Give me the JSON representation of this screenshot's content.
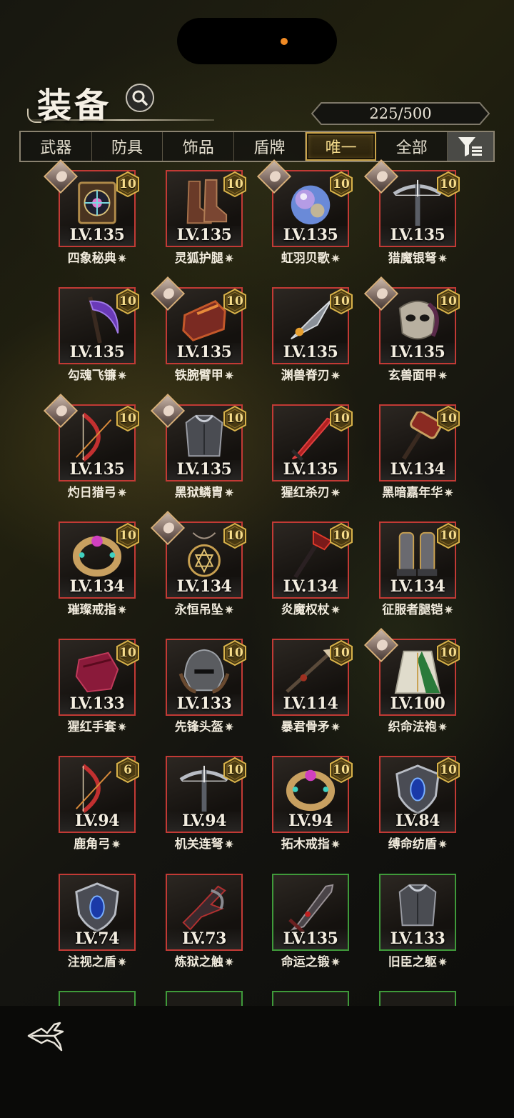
{
  "header": {
    "title": "装备",
    "count": "225/500"
  },
  "tabs": [
    {
      "label": "武器"
    },
    {
      "label": "防具"
    },
    {
      "label": "饰品"
    },
    {
      "label": "盾牌"
    },
    {
      "label": "唯一",
      "active": true
    },
    {
      "label": "全部"
    }
  ],
  "colors": {
    "rare": "#c23a35",
    "uncommon": "#3f9a3a",
    "gold": "#c8a24a"
  },
  "items": [
    {
      "name": "四象秘典",
      "level": "LV.135",
      "enhance": "10",
      "avatar": true,
      "frame": "red",
      "icon": "tome-icon"
    },
    {
      "name": "灵狐护腿",
      "level": "LV.135",
      "enhance": "10",
      "avatar": false,
      "frame": "red",
      "icon": "boots-icon"
    },
    {
      "name": "虹羽贝歌",
      "level": "LV.135",
      "enhance": "10",
      "avatar": true,
      "frame": "red",
      "icon": "orb-icon"
    },
    {
      "name": "猎魔银弩",
      "level": "LV.135",
      "enhance": "10",
      "avatar": true,
      "frame": "red",
      "icon": "crossbow-icon"
    },
    {
      "name": "勾魂飞镰",
      "level": "LV.135",
      "enhance": "10",
      "avatar": false,
      "frame": "red",
      "icon": "scythe-icon"
    },
    {
      "name": "铁腕臂甲",
      "level": "LV.135",
      "enhance": "10",
      "avatar": true,
      "frame": "red",
      "icon": "gauntlet-icon"
    },
    {
      "name": "渊兽脊刃",
      "level": "LV.135",
      "enhance": "10",
      "avatar": false,
      "frame": "red",
      "icon": "blade-icon"
    },
    {
      "name": "玄兽面甲",
      "level": "LV.135",
      "enhance": "10",
      "avatar": true,
      "frame": "red",
      "icon": "mask-icon"
    },
    {
      "name": "灼日猎弓",
      "level": "LV.135",
      "enhance": "10",
      "avatar": true,
      "frame": "red",
      "icon": "bow-icon"
    },
    {
      "name": "黑狱鳞胄",
      "level": "LV.135",
      "enhance": "10",
      "avatar": true,
      "frame": "red",
      "icon": "armor-icon"
    },
    {
      "name": "猩红杀刃",
      "level": "LV.135",
      "enhance": "10",
      "avatar": false,
      "frame": "red",
      "icon": "sword-icon"
    },
    {
      "name": "黑暗嘉年华",
      "level": "LV.134",
      "enhance": "10",
      "avatar": false,
      "frame": "red",
      "icon": "hammer-icon"
    },
    {
      "name": "璀璨戒指",
      "level": "LV.134",
      "enhance": "10",
      "avatar": false,
      "frame": "red",
      "icon": "ring-icon"
    },
    {
      "name": "永恒吊坠",
      "level": "LV.134",
      "enhance": "10",
      "avatar": true,
      "frame": "red",
      "icon": "pendant-icon"
    },
    {
      "name": "炎魔权杖",
      "level": "LV.134",
      "enhance": "10",
      "avatar": false,
      "frame": "red",
      "icon": "staff-icon"
    },
    {
      "name": "征服者腿铠",
      "level": "LV.134",
      "enhance": "10",
      "avatar": false,
      "frame": "red",
      "icon": "greaves-icon"
    },
    {
      "name": "猩红手套",
      "level": "LV.133",
      "enhance": "10",
      "avatar": false,
      "frame": "red",
      "icon": "glove-icon"
    },
    {
      "name": "先锋头盔",
      "level": "LV.133",
      "enhance": "10",
      "avatar": false,
      "frame": "red",
      "icon": "helmet-icon"
    },
    {
      "name": "暴君骨矛",
      "level": "LV.114",
      "enhance": "10",
      "avatar": false,
      "frame": "red",
      "icon": "spear-icon"
    },
    {
      "name": "织命法袍",
      "level": "LV.100",
      "enhance": "10",
      "avatar": true,
      "frame": "red",
      "icon": "robe-icon"
    },
    {
      "name": "鹿角弓",
      "level": "LV.94",
      "enhance": "6",
      "avatar": false,
      "frame": "red",
      "icon": "bow-icon"
    },
    {
      "name": "机关连弩",
      "level": "LV.94",
      "enhance": "10",
      "avatar": false,
      "frame": "red",
      "icon": "crossbow-icon"
    },
    {
      "name": "拓木戒指",
      "level": "LV.94",
      "enhance": "10",
      "avatar": false,
      "frame": "red",
      "icon": "ring-icon"
    },
    {
      "name": "缚命纺盾",
      "level": "LV.84",
      "enhance": "10",
      "avatar": false,
      "frame": "red",
      "icon": "shield-icon"
    },
    {
      "name": "注视之盾",
      "level": "LV.74",
      "enhance": null,
      "avatar": false,
      "frame": "red",
      "icon": "shield-icon"
    },
    {
      "name": "炼狱之触",
      "level": "LV.73",
      "enhance": null,
      "avatar": false,
      "frame": "red",
      "icon": "claw-icon"
    },
    {
      "name": "命运之锻",
      "level": "LV.135",
      "enhance": null,
      "avatar": false,
      "frame": "green",
      "icon": "greatsword-icon"
    },
    {
      "name": "旧臣之躯",
      "level": "LV.133",
      "enhance": null,
      "avatar": false,
      "frame": "green",
      "icon": "armor-icon"
    }
  ],
  "footer": {
    "back_icon": "back-arrow-icon"
  }
}
